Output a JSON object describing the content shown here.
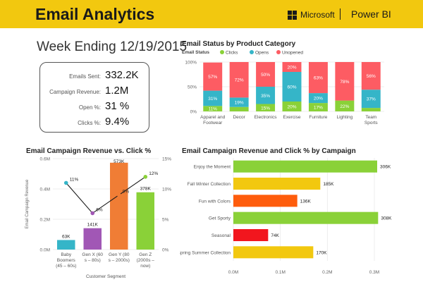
{
  "header": {
    "title": "Email Analytics",
    "microsoft_label": "Microsoft",
    "powerbi_label": "Power BI"
  },
  "week_label": "Week Ending 12/19/2015",
  "kpis": [
    {
      "label": "Emails Sent:",
      "value": "332.2K"
    },
    {
      "label": "Campaign Revenue:",
      "value": "1.2M"
    },
    {
      "label": "Open %:",
      "value": "31 %"
    },
    {
      "label": "Clicks %:",
      "value": "9.4%"
    }
  ],
  "colors": {
    "header": "#f2c80f",
    "clicks": "#8ad138",
    "opens": "#35b5c8",
    "unopened": "#fd5c63"
  },
  "chart_data": [
    {
      "type": "bar",
      "stacked": true,
      "title": "Email Status by Product Category",
      "legend_title": "Email Status",
      "legend_position": "top-left",
      "categories": [
        "Apparel and Footwear",
        "Decor",
        "Electronics",
        "Exercise",
        "Furniture",
        "Lighting",
        "Team Sports"
      ],
      "category_lines": [
        [
          "Apparel and",
          "Footwear"
        ],
        [
          "Decor"
        ],
        [
          "Electronics"
        ],
        [
          "Exercise"
        ],
        [
          "Furniture"
        ],
        [
          "Lighting"
        ],
        [
          "Team",
          "Sports"
        ]
      ],
      "series": [
        {
          "name": "Clicks",
          "color": "#8ad138",
          "values": [
            11,
            9,
            15,
            20,
            17,
            22,
            7
          ],
          "labels": [
            "11%",
            "",
            "15%",
            "20%",
            "17%",
            "22%",
            ""
          ]
        },
        {
          "name": "Opens",
          "color": "#35b5c8",
          "values": [
            31,
            19,
            35,
            60,
            20,
            0,
            37
          ],
          "labels": [
            "31%",
            "19%",
            "35%",
            "60%",
            "20%",
            "",
            "37%"
          ]
        },
        {
          "name": "Unopened",
          "color": "#fd5c63",
          "values": [
            57,
            72,
            50,
            20,
            63,
            78,
            56
          ],
          "labels": [
            "57%",
            "72%",
            "50%",
            "20%",
            "63%",
            "78%",
            "56%"
          ]
        }
      ],
      "yticks": [
        "0%",
        "50%",
        "100%"
      ],
      "ylim": [
        0,
        100
      ],
      "grid": true
    },
    {
      "type": "bar",
      "combo": "bar+line",
      "title": "Email Campaign Revenue vs. Click %",
      "xlabel": "Customer Segment",
      "ylabel": "Email Campaign Revenue",
      "categories": [
        "Baby Boomers (45 – 60s)",
        "Gen X (60s – 80s)",
        "Gen Y (80s – 2000s)",
        "Gen Z (2000s – now)"
      ],
      "category_lines": [
        [
          "Baby",
          "Boomers",
          "(45 – 60s)"
        ],
        [
          "Gen X (60",
          "s – 80s)"
        ],
        [
          "Gen Y (80",
          "s – 2000s)"
        ],
        [
          "Gen Z",
          "(2000s –",
          "now)"
        ]
      ],
      "bar_values": [
        63000,
        141000,
        573000,
        378000
      ],
      "bar_labels": [
        "63K",
        "141K",
        "573K",
        "378K"
      ],
      "bar_colors": [
        "#35b5c8",
        "#a157b5",
        "#f07d35",
        "#8ad138"
      ],
      "line_values": [
        11,
        6,
        9,
        12
      ],
      "line_labels": [
        "11%",
        "6%",
        "9%",
        "12%"
      ],
      "yticks_left": [
        "0.0M",
        "0.2M",
        "0.4M",
        "0.6M"
      ],
      "yticks_right": [
        "0%",
        "5%",
        "10%",
        "15%"
      ],
      "ylim_left": [
        0,
        600000
      ],
      "ylim_right": [
        0,
        15
      ],
      "grid": true
    },
    {
      "type": "bar",
      "orientation": "horizontal",
      "title": "Email Campaign Revenue and Click % by Campaign",
      "categories": [
        "Enjoy the Moment",
        "Fall Winter Collection",
        "Fun with Colors",
        "Get Sporty",
        "Seasonal",
        "Spring Summer Collection"
      ],
      "values": [
        306000,
        185000,
        136000,
        308000,
        74000,
        170000
      ],
      "labels": [
        "306K",
        "185K",
        "136K",
        "308K",
        "74K",
        "170K"
      ],
      "colors": [
        "#8ad138",
        "#f2c80f",
        "#fe5c0c",
        "#8ad138",
        "#f2161e",
        "#f2c80f"
      ],
      "xticks": [
        "0.0M",
        "0.1M",
        "0.2M",
        "0.3M"
      ],
      "xlim": [
        0,
        300000
      ],
      "grid": true
    }
  ]
}
